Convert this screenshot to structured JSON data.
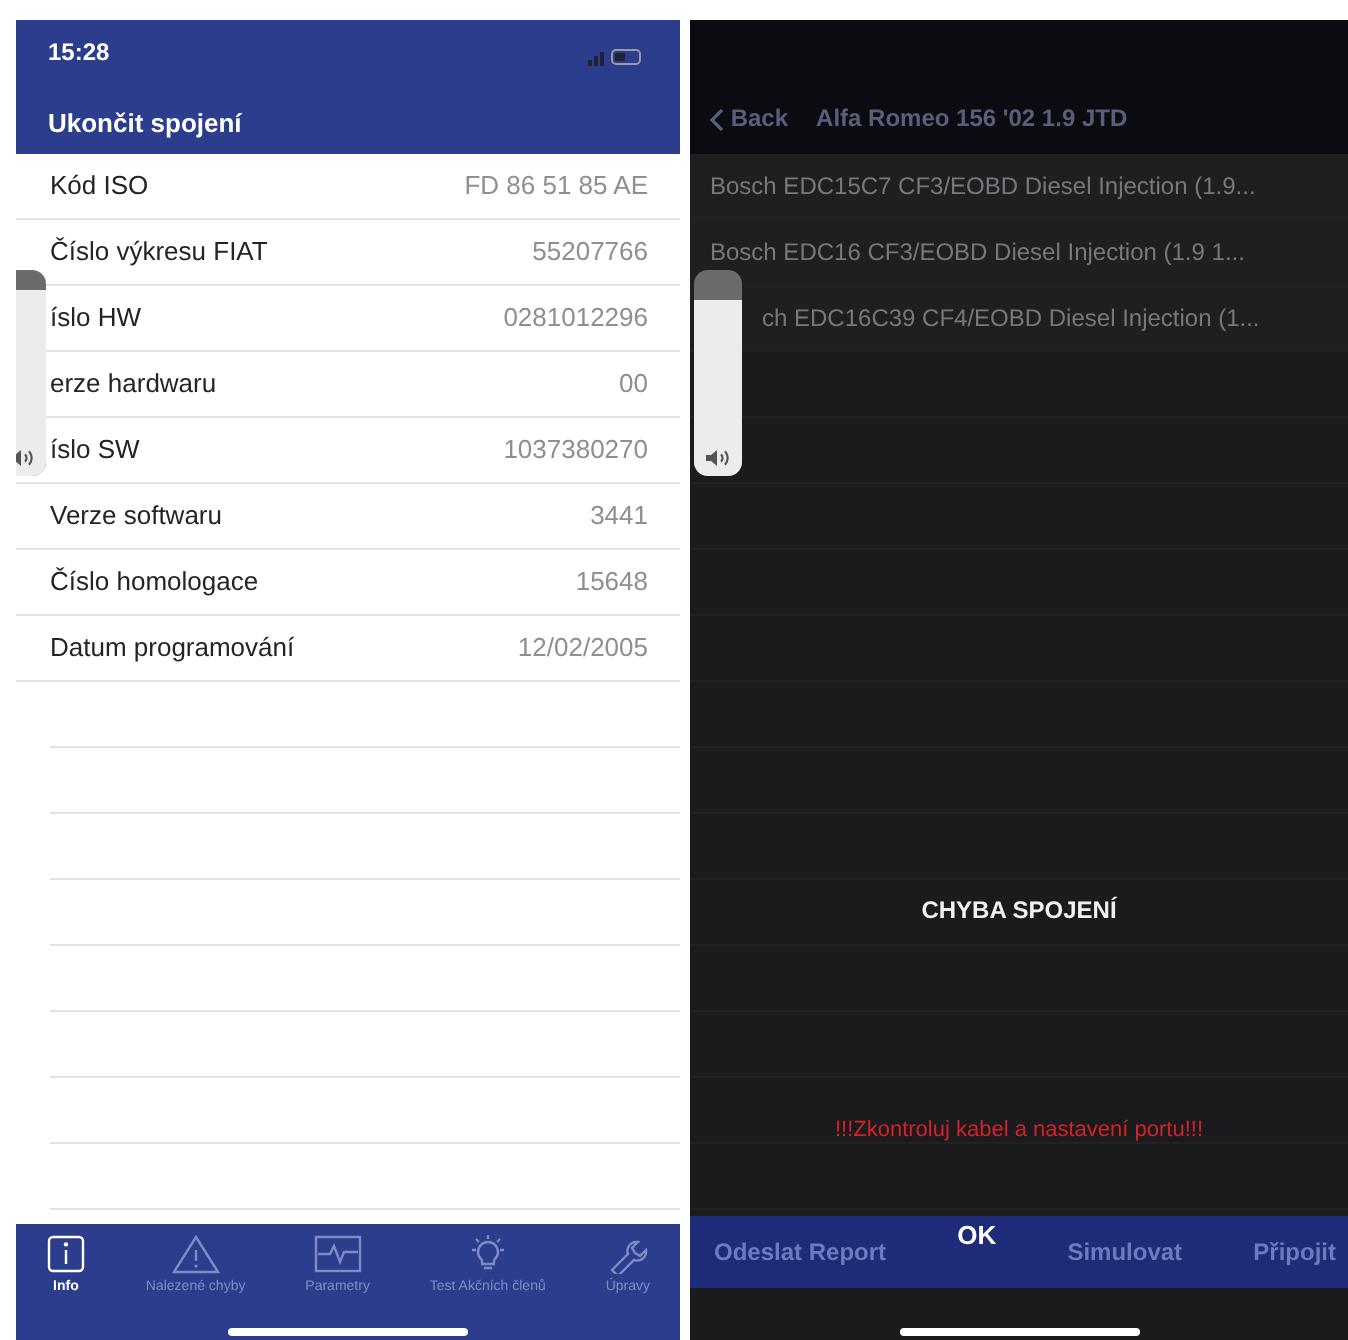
{
  "left_screen": {
    "status_bar": {
      "time": "15:28"
    },
    "nav_title": "Ukončit spojení",
    "info_rows": [
      {
        "label": "Kód ISO",
        "value": "FD 86 51 85 AE"
      },
      {
        "label": "Číslo výkresu FIAT",
        "value": "55207766"
      },
      {
        "label": "íslo HW",
        "value": "0281012296"
      },
      {
        "label": "erze hardwaru",
        "value": "00"
      },
      {
        "label": "íslo SW",
        "value": "1037380270"
      },
      {
        "label": "Verze softwaru",
        "value": "3441"
      },
      {
        "label": "Číslo homologace",
        "value": "15648"
      },
      {
        "label": "Datum programování",
        "value": "12/02/2005"
      }
    ],
    "volume_hud": {
      "level": 0.9
    },
    "tab_bar": [
      {
        "label": "Info",
        "selected": true
      },
      {
        "label": "Nalezené chyby",
        "selected": false
      },
      {
        "label": "Parametry",
        "selected": false
      },
      {
        "label": "Test Akčních členů",
        "selected": false
      },
      {
        "label": "Úpravy",
        "selected": false
      }
    ]
  },
  "right_screen": {
    "nav": {
      "back": "Back",
      "title": "Alfa Romeo 156 '02 1.9 JTD"
    },
    "ecu_list": [
      "Bosch EDC15C7 CF3/EOBD Diesel Injection (1.9...",
      "Bosch EDC16 CF3/EOBD Diesel Injection (1.9 1...",
      "ch EDC16C39 CF4/EOBD Diesel Injection (1..."
    ],
    "volume_hud": {
      "level": 0.85
    },
    "alert": {
      "title": "CHYBA SPOJENÍ",
      "message": "!!!Zkontroluj kabel a nastavení portu!!!"
    },
    "bottom_bar": [
      {
        "label": "Odeslat Report",
        "kind": "dimmed"
      },
      {
        "label": "OK",
        "kind": "alert"
      },
      {
        "label": "Simulovat",
        "kind": "dimmed"
      },
      {
        "label": "Připojit",
        "kind": "dimmed"
      }
    ]
  }
}
